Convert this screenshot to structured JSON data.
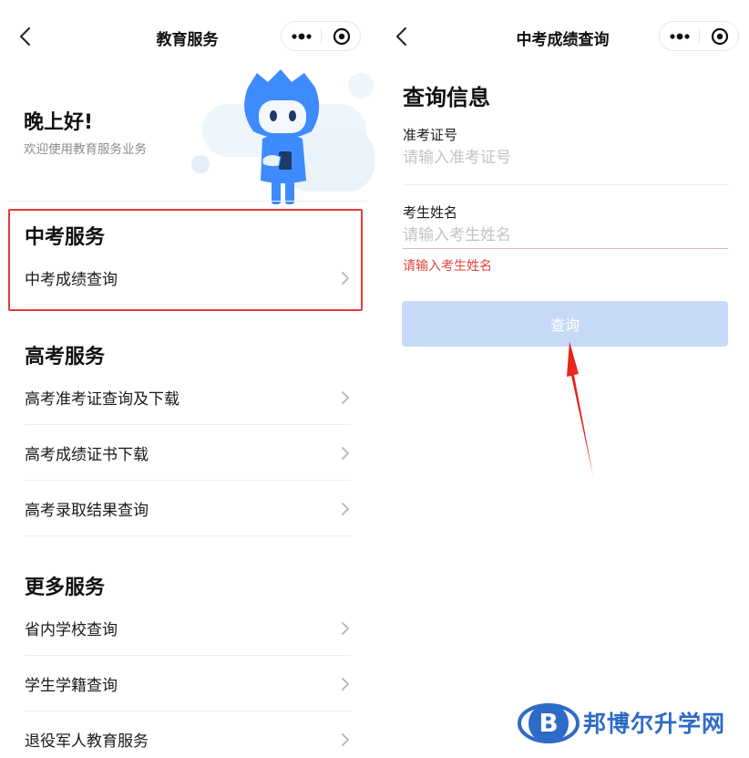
{
  "left": {
    "nav_title": "教育服务",
    "greeting": "晚上好!",
    "subgreeting": "欢迎使用教育服务业务",
    "sections": [
      {
        "title": "中考服务",
        "items": [
          "中考成绩查询"
        ]
      },
      {
        "title": "高考服务",
        "items": [
          "高考准考证查询及下载",
          "高考成绩证书下载",
          "高考录取结果查询"
        ]
      },
      {
        "title": "更多服务",
        "items": [
          "省内学校查询",
          "学生学籍查询",
          "退役军人教育服务"
        ]
      }
    ]
  },
  "right": {
    "nav_title": "中考成绩查询",
    "heading": "查询信息",
    "fields": [
      {
        "label": "准考证号",
        "placeholder": "请输入准考证号",
        "value": ""
      },
      {
        "label": "考生姓名",
        "placeholder": "请输入考生姓名",
        "value": "",
        "error": "请输入考生姓名"
      }
    ],
    "submit_label": "查询"
  },
  "watermark": {
    "text": "邦博尔升学网",
    "logo_letter": "B"
  },
  "colors": {
    "highlight": "#e53a3a",
    "button_disabled": "#c6daf7",
    "error_text": "#e2433c",
    "brand_blue": "#2d6bc7",
    "mascot_blue": "#3d8bff"
  },
  "icons": {
    "back": "chevron-left-icon",
    "more": "more-dots-icon",
    "close": "target-circle-icon",
    "row": "chevron-right-icon"
  }
}
